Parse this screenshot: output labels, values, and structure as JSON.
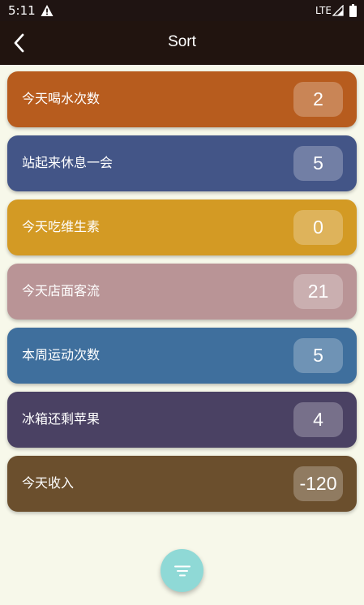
{
  "status_bar": {
    "time": "5:11",
    "network": "LTE",
    "icons": [
      "alert-icon",
      "signal-icon",
      "battery-icon"
    ]
  },
  "app_bar": {
    "title": "Sort",
    "back_icon": "chevron-left-icon"
  },
  "counters": [
    {
      "label": "今天喝水次数",
      "count": "2",
      "color": "#b75c1e"
    },
    {
      "label": "站起来休息一会",
      "count": "5",
      "color": "#435587"
    },
    {
      "label": "今天吃维生素",
      "count": "0",
      "color": "#d39a24"
    },
    {
      "label": "今天店面客流",
      "count": "21",
      "color": "#b99496"
    },
    {
      "label": "本周运动次数",
      "count": "5",
      "color": "#3f6f9d"
    },
    {
      "label": "冰箱还剩苹果",
      "count": "4",
      "color": "#4a4163"
    },
    {
      "label": "今天收入",
      "count": "-120",
      "color": "#6b4f2d"
    }
  ],
  "fab": {
    "icon": "sort-icon",
    "color": "#8fd9d6"
  }
}
